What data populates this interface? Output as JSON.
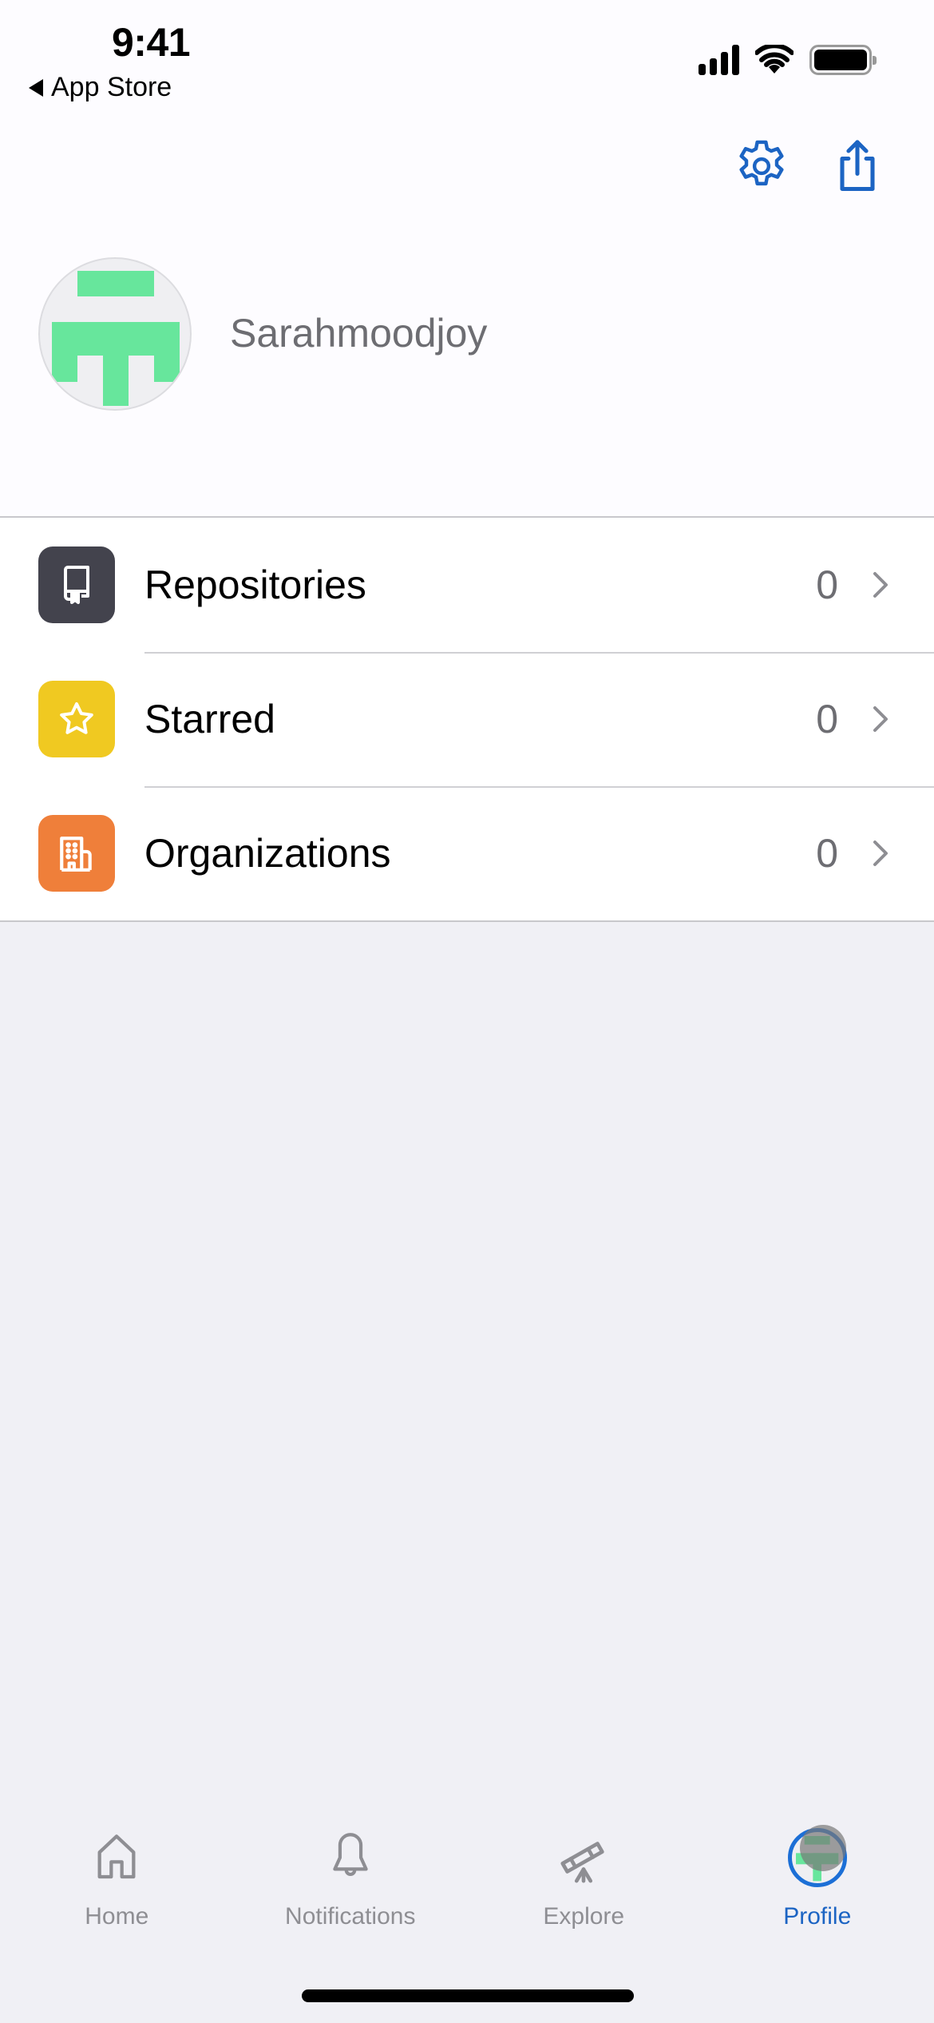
{
  "status_bar": {
    "time": "9:41",
    "back_app_label": "App Store"
  },
  "nav": {
    "settings_icon": "gear-icon",
    "share_icon": "share-icon",
    "accent_color": "#1c64c3"
  },
  "profile": {
    "username": "Sarahmoodjoy",
    "avatar_color": "#67e69c"
  },
  "list": {
    "items": [
      {
        "label": "Repositories",
        "count": "0",
        "icon": "repo-book-icon",
        "icon_bg": "#43434d"
      },
      {
        "label": "Starred",
        "count": "0",
        "icon": "star-icon",
        "icon_bg": "#f0c921"
      },
      {
        "label": "Organizations",
        "count": "0",
        "icon": "building-icon",
        "icon_bg": "#ef7f3a"
      }
    ]
  },
  "tabbar": {
    "tabs": [
      {
        "label": "Home",
        "icon": "house-icon",
        "active": false
      },
      {
        "label": "Notifications",
        "icon": "bell-icon",
        "active": false
      },
      {
        "label": "Explore",
        "icon": "telescope-icon",
        "active": false
      },
      {
        "label": "Profile",
        "icon": "avatar-icon",
        "active": true
      }
    ],
    "active_color": "#1c64c3",
    "inactive_color": "#8e8e93"
  }
}
